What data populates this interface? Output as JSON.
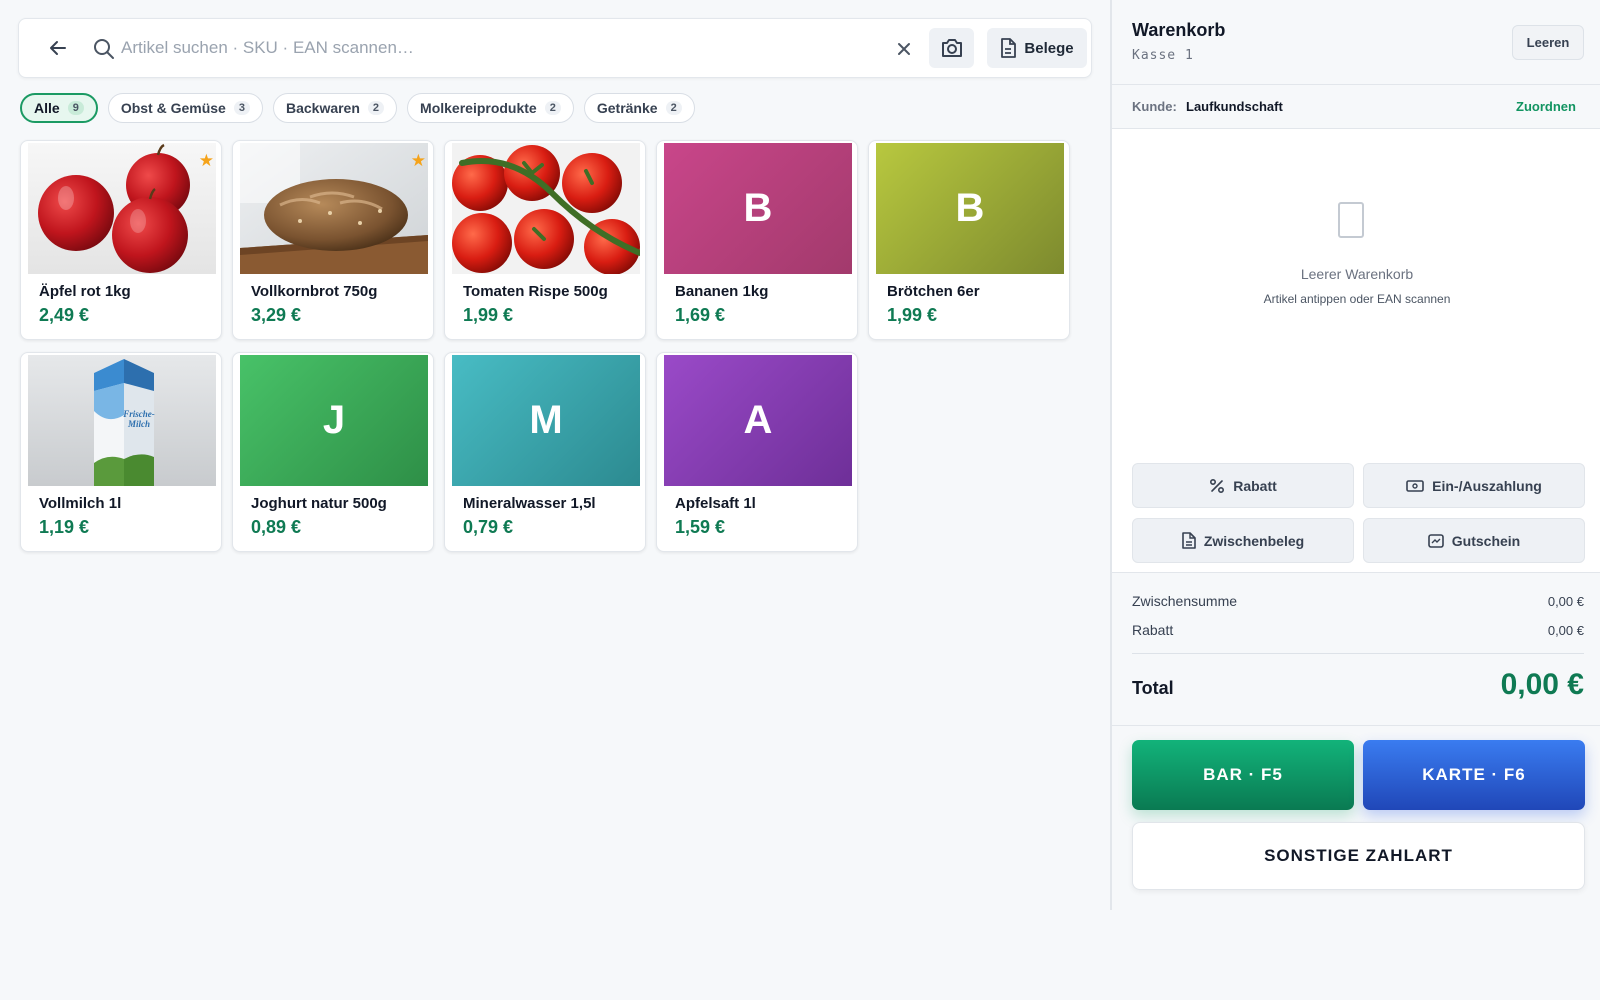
{
  "search": {
    "placeholder": "Artikel suchen · SKU · EAN scannen…",
    "belege_label": "Belege"
  },
  "categories": [
    {
      "label": "Alle",
      "count": "9",
      "active": true
    },
    {
      "label": "Obst & Gemüse",
      "count": "3",
      "active": false
    },
    {
      "label": "Backwaren",
      "count": "2",
      "active": false
    },
    {
      "label": "Molkereiprodukte",
      "count": "2",
      "active": false
    },
    {
      "label": "Getränke",
      "count": "2",
      "active": false
    }
  ],
  "products": [
    {
      "name": "Äpfel rot 1kg",
      "price": "2,49 €",
      "image": "apples",
      "favorite": true
    },
    {
      "name": "Vollkornbrot 750g",
      "price": "3,29 €",
      "image": "bread",
      "favorite": true
    },
    {
      "name": "Tomaten Rispe 500g",
      "price": "1,99 €",
      "image": "tomatoes",
      "favorite": false
    },
    {
      "name": "Bananen 1kg",
      "price": "1,69 €",
      "letter": "B",
      "color": "#b8417a"
    },
    {
      "name": "Brötchen 6er",
      "price": "1,99 €",
      "letter": "B",
      "color": "#9aa83a"
    },
    {
      "name": "Vollmilch 1l",
      "price": "1,19 €",
      "image": "milk",
      "favorite": false,
      "image_text": "Frische-Milch"
    },
    {
      "name": "Joghurt natur 500g",
      "price": "0,89 €",
      "letter": "J",
      "color": "#3cad58"
    },
    {
      "name": "Mineralwasser 1,5l",
      "price": "0,79 €",
      "letter": "M",
      "color": "#3aa3ab"
    },
    {
      "name": "Apfelsaft 1l",
      "price": "1,59 €",
      "letter": "A",
      "color": "#8a3fb3"
    }
  ],
  "cart": {
    "title": "Warenkorb",
    "register": "Kasse 1",
    "clear_label": "Leeren",
    "customer_label": "Kunde:",
    "customer_value": "Laufkundschaft",
    "assign_label": "Zuordnen",
    "empty_title": "Leerer Warenkorb",
    "empty_sub": "Artikel antippen oder EAN scannen"
  },
  "actions": {
    "discount": "Rabatt",
    "cash_inout": "Ein-/Auszahlung",
    "interim_receipt": "Zwischenbeleg",
    "voucher": "Gutschein"
  },
  "totals": {
    "subtotal_label": "Zwischensumme",
    "subtotal_value": "0,00 €",
    "discount_label": "Rabatt",
    "discount_value": "0,00 €",
    "total_label": "Total",
    "total_value": "0,00 €"
  },
  "payment": {
    "cash": "BAR · F5",
    "card": "KARTE · F6",
    "other": "SONSTIGE ZAHLART"
  },
  "colors": {
    "accent_green": "#0f7a53",
    "card_blue": "#2f64d8",
    "favorite_star": "#f5a31a"
  }
}
